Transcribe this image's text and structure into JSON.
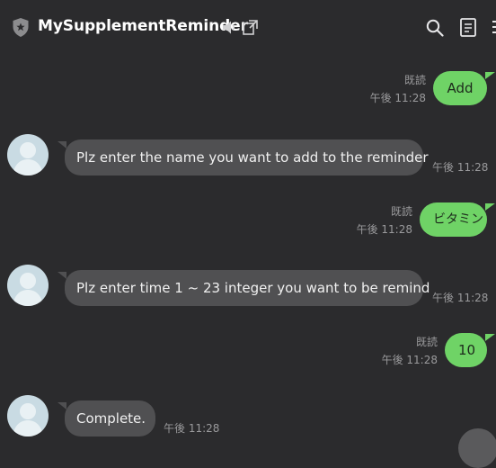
{
  "header": {
    "title": "MySupplementReminder",
    "icons": [
      "shield-icon",
      "speaker-mute-icon",
      "popout-icon",
      "search-icon",
      "notes-icon"
    ]
  },
  "messages": [
    {
      "side": "out",
      "text": "Add",
      "read": "既読",
      "time": "午後 11:28"
    },
    {
      "side": "in",
      "text": "Plz enter the name you want to add to the reminder",
      "time": "午後 11:28"
    },
    {
      "side": "out",
      "text": "ビタミン",
      "read": "既読",
      "time": "午後 11:28"
    },
    {
      "side": "in",
      "text": "Plz enter time 1 ~ 23 integer you want to be remind",
      "time": "午後 11:28"
    },
    {
      "side": "out",
      "text": "10",
      "read": "既読",
      "time": "午後 11:28"
    },
    {
      "side": "in",
      "text": "Complete.",
      "time": "午後 11:28"
    }
  ],
  "colors": {
    "background": "#2b2b2d",
    "outgoing_bubble": "#6fd366",
    "incoming_bubble": "#505052",
    "meta_text": "#9a9a9c"
  }
}
